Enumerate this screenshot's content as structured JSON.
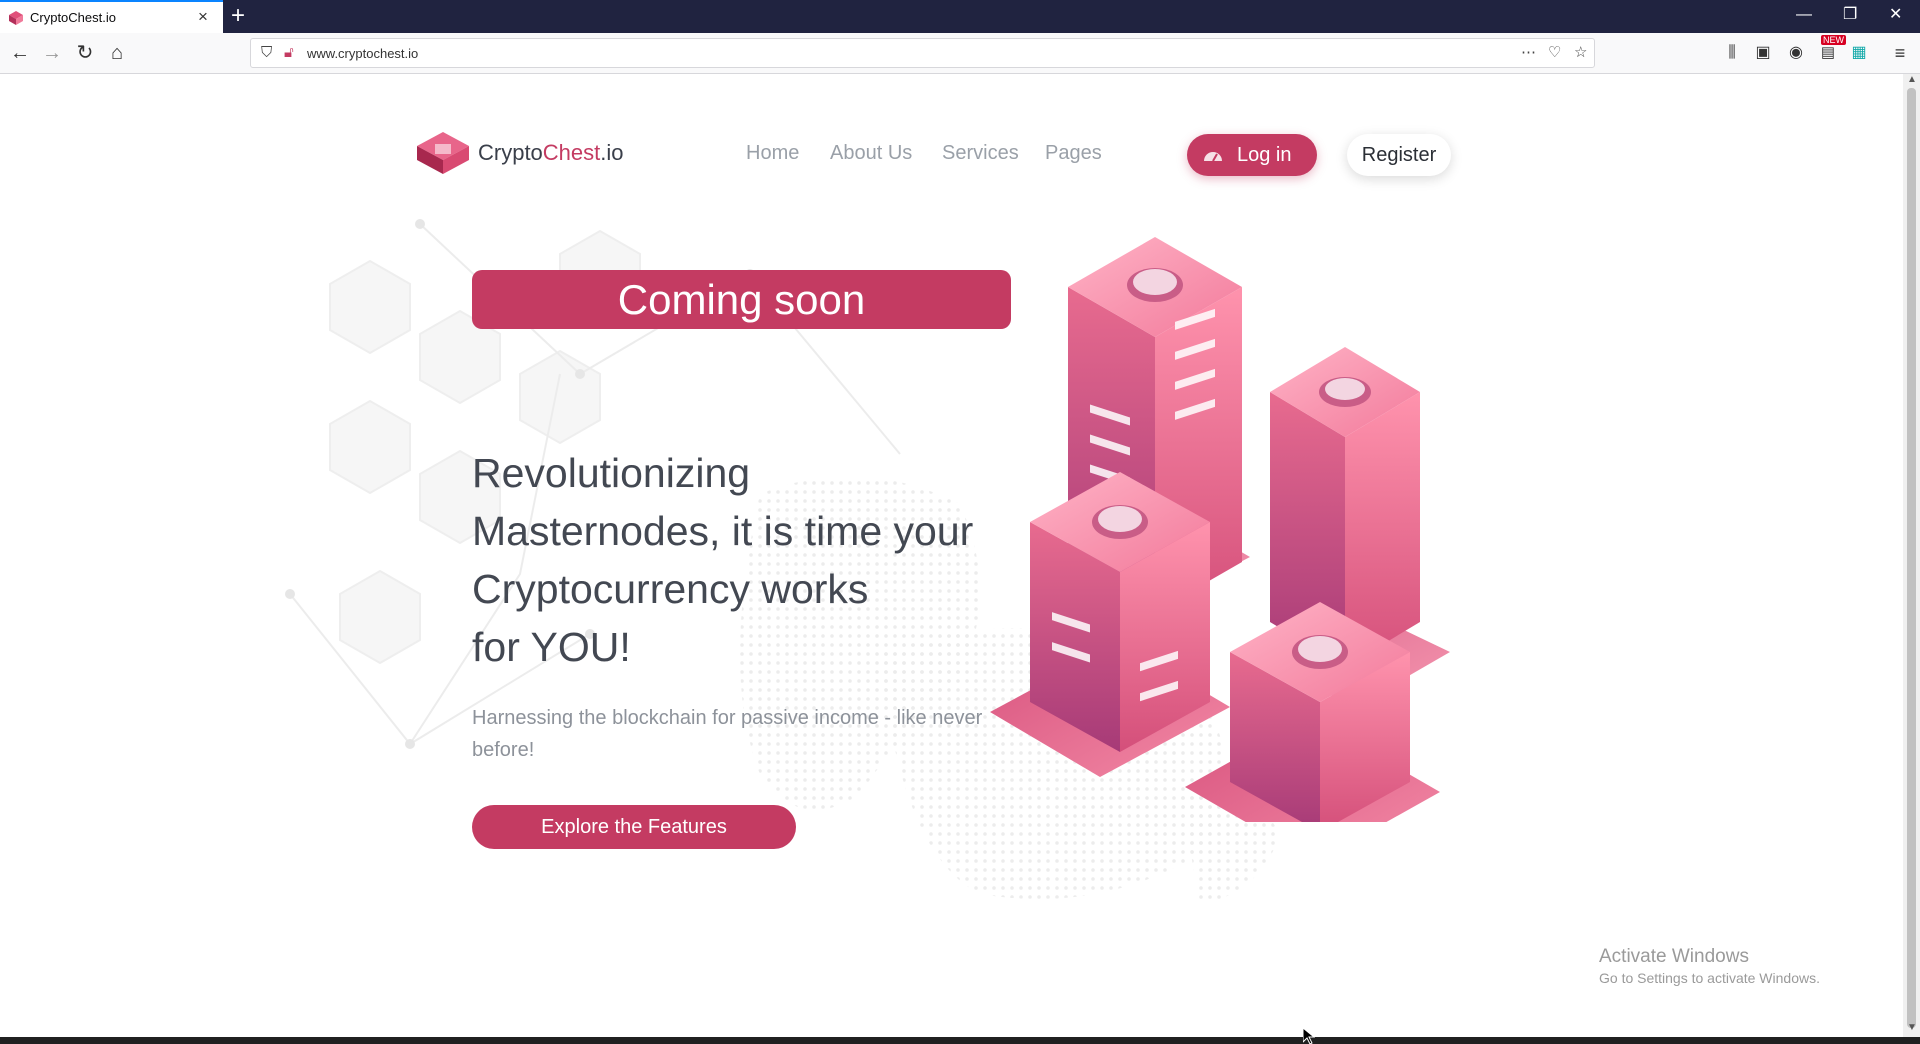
{
  "browser": {
    "tab_title": "CryptoChest.io",
    "url": "www.cryptochest.io",
    "new_badge": "NEW"
  },
  "site": {
    "logo": {
      "part1": "Crypto",
      "part2": "Chest",
      "part3": ".io"
    },
    "nav": [
      "Home",
      "About Us",
      "Services",
      "Pages"
    ],
    "login_label": "Log in",
    "register_label": "Register",
    "coming_soon": "Coming soon",
    "headline": [
      "Revolutionizing",
      "Masternodes, it is time your",
      "Cryptocurrency works",
      "for YOU!"
    ],
    "subtext": "Harnessing the blockchain for passive income - like never before!",
    "cta_label": "Explore the Features"
  },
  "overlay": {
    "activate_title": "Activate Windows",
    "activate_sub": "Go to Settings to activate Windows."
  },
  "colors": {
    "brand": "#c43b62",
    "tabbar": "#202340",
    "text_dark": "#434852",
    "text_muted": "#8d929a"
  }
}
